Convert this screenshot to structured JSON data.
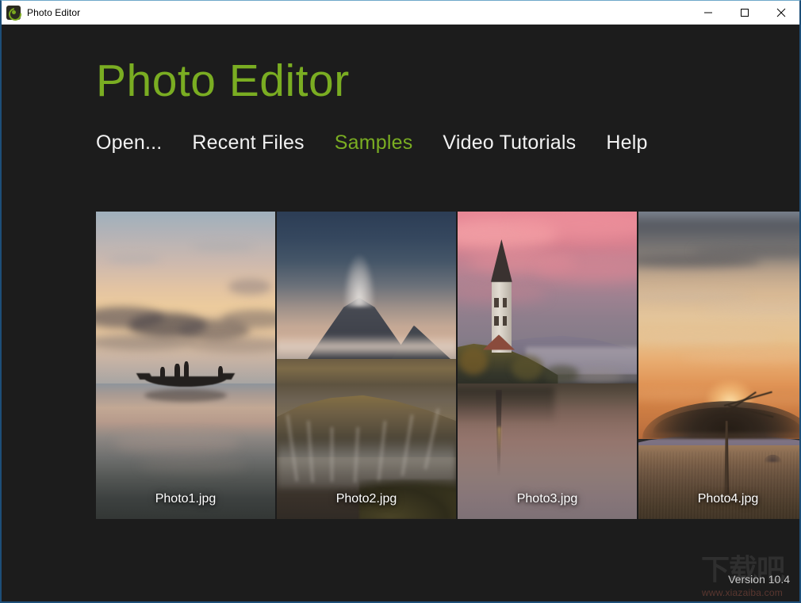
{
  "titlebar": {
    "app_icon": "photo-editor-aperture-icon",
    "title": "Photo Editor",
    "minimize_label": "minimize-icon",
    "maximize_label": "maximize-icon",
    "close_label": "close-icon"
  },
  "header": {
    "app_title": "Photo Editor",
    "accent_color": "#7aad22",
    "background_color": "#1c1c1c"
  },
  "nav": {
    "items": [
      {
        "label": "Open...",
        "active": false
      },
      {
        "label": "Recent Files",
        "active": false
      },
      {
        "label": "Samples",
        "active": true
      },
      {
        "label": "Video Tutorials",
        "active": false
      },
      {
        "label": "Help",
        "active": false
      }
    ]
  },
  "gallery": {
    "items": [
      {
        "label": "Photo1.jpg",
        "scene": "sunrise lake with fishing boat silhouette"
      },
      {
        "label": "Photo2.jpg",
        "scene": "Mount Bromo volcano with smoke plume"
      },
      {
        "label": "Photo3.jpg",
        "scene": "Lake Bled church at pink dusk"
      },
      {
        "label": "Photo4.jpg",
        "scene": "acacia tree in savanna at sunset"
      }
    ]
  },
  "footer": {
    "version": "Version 10.4",
    "watermark_cn": "下载吧",
    "watermark_url": "www.xiazaiba.com"
  }
}
